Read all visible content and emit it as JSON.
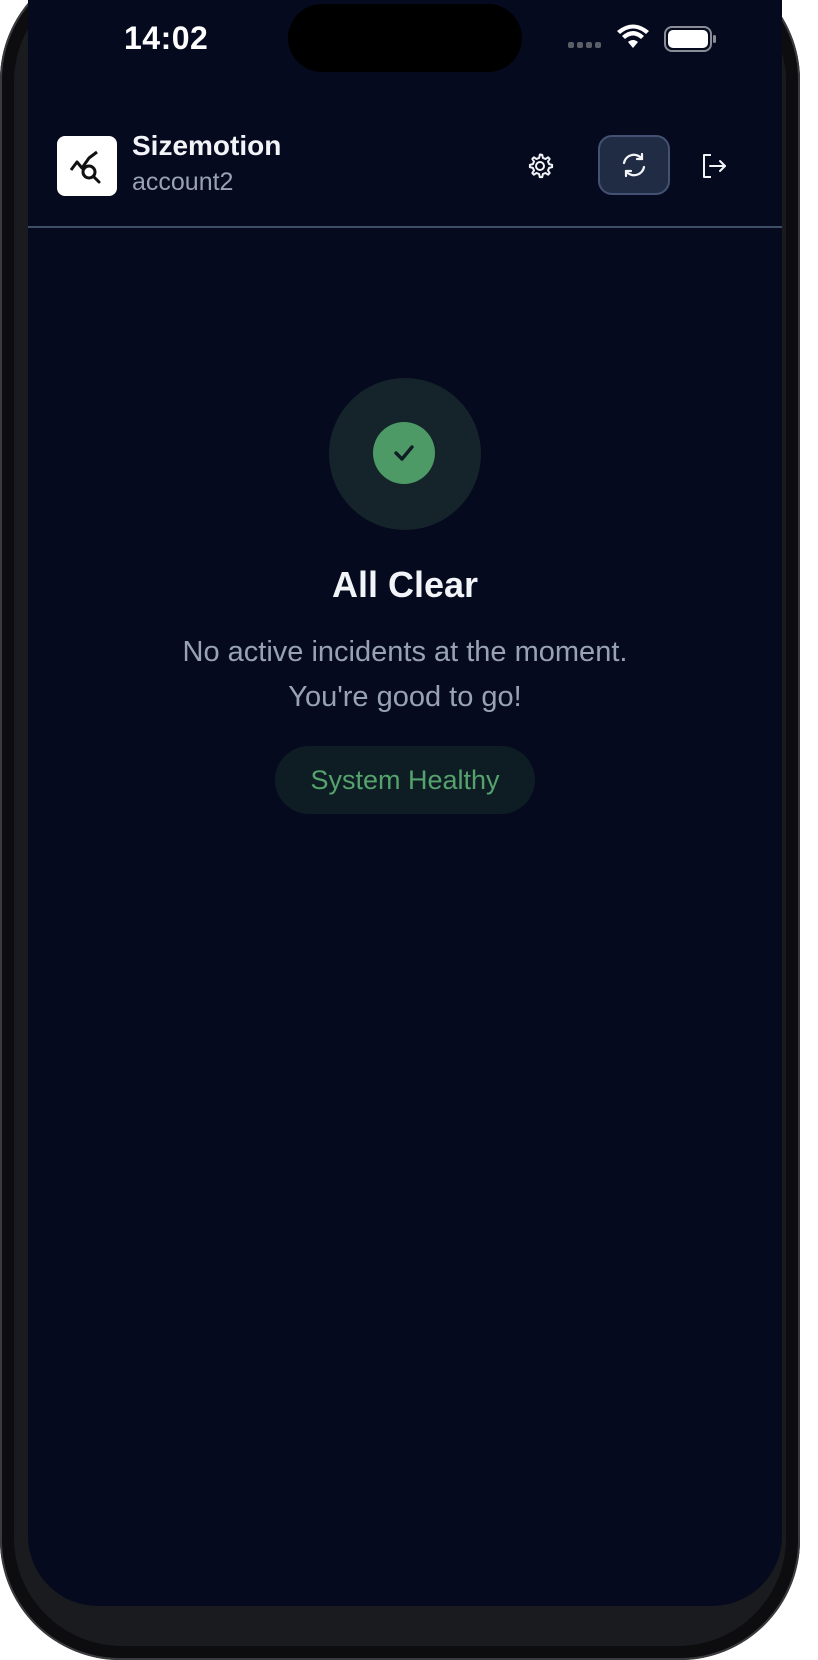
{
  "status_bar": {
    "time": "14:02",
    "icons": [
      "cellular-signal-icon",
      "wifi-icon",
      "battery-icon"
    ]
  },
  "header": {
    "logo_icon": "chart-search-icon",
    "app_name": "Sizemotion",
    "account": "account2",
    "actions": [
      {
        "name": "settings",
        "icon": "gear-icon"
      },
      {
        "name": "refresh",
        "icon": "refresh-icon",
        "active": true
      },
      {
        "name": "logout",
        "icon": "logout-icon"
      }
    ]
  },
  "empty_state": {
    "icon": "check-icon",
    "title": "All Clear",
    "message_line1": "No active incidents at the moment.",
    "message_line2": "You're good to go!",
    "status_badge": "System Healthy"
  },
  "colors": {
    "background": "#050a1f",
    "accent_green": "#4d9a66",
    "badge_text": "#55a26d",
    "muted_text": "#98a2b6",
    "header_divider": "#3f4e66"
  }
}
